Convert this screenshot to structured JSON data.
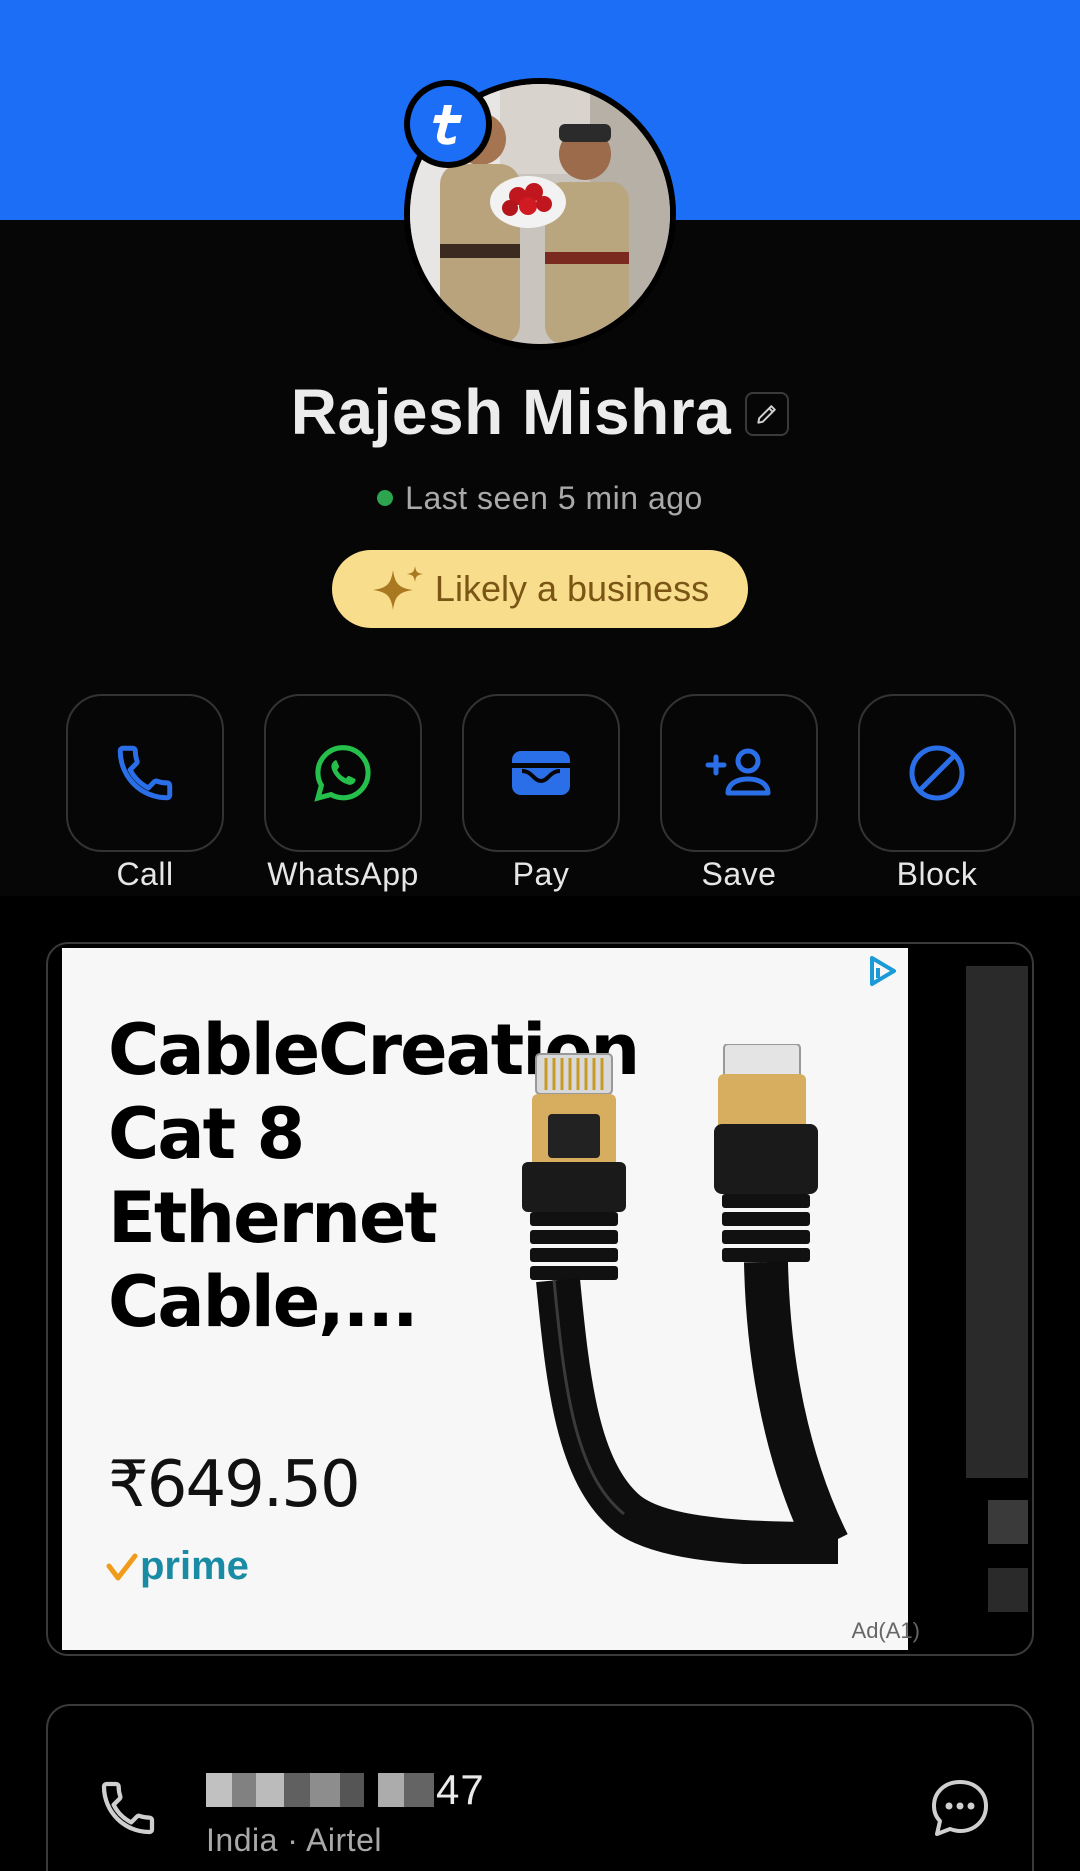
{
  "profile": {
    "name": "Rajesh Mishra",
    "status_text": "Last seen 5 min ago",
    "badge_label": "Likely a business"
  },
  "actions": [
    {
      "label": "Call",
      "icon": "phone-icon"
    },
    {
      "label": "WhatsApp",
      "icon": "whatsapp-icon"
    },
    {
      "label": "Pay",
      "icon": "wallet-icon"
    },
    {
      "label": "Save",
      "icon": "add-contact-icon"
    },
    {
      "label": "Block",
      "icon": "block-icon"
    }
  ],
  "ad": {
    "title": "CableCreation Cat 8 Ethernet Cable,...",
    "price": "₹649.50",
    "prime_label": "prime",
    "ad_tag": "Ad(A1)"
  },
  "contact": {
    "number_suffix": "47",
    "meta": "India · Airtel"
  },
  "colors": {
    "brand_blue": "#1b6ef5",
    "badge_bg": "#f8dd8d",
    "badge_text": "#7a5513",
    "online_green": "#2da44e",
    "whatsapp_green": "#25c04c"
  }
}
